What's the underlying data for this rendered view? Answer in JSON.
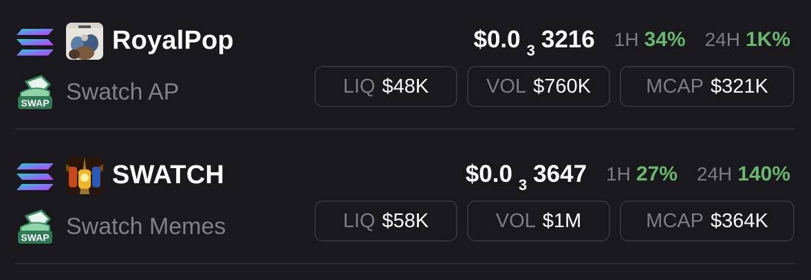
{
  "colors": {
    "background": "#19181d",
    "positive": "#67b86d",
    "muted": "#7d7c82",
    "border": "#333238"
  },
  "tokens": [
    {
      "chain_icon": "solana-icon",
      "name": "RoyalPop",
      "dex": "Swatch AP",
      "swap_badge": "SWAP",
      "price_prefix": "$0.0",
      "price_zeros": "3",
      "price_digits": "3216",
      "change_1h_label": "1H",
      "change_1h": "34%",
      "change_24h_label": "24H",
      "change_24h": "1K%",
      "liq_label": "LIQ",
      "liq": "$48K",
      "vol_label": "VOL",
      "vol": "$760K",
      "mcap_label": "MCAP",
      "mcap": "$321K"
    },
    {
      "chain_icon": "solana-icon",
      "name": "SWATCH",
      "dex": "Swatch Memes",
      "swap_badge": "SWAP",
      "price_prefix": "$0.0",
      "price_zeros": "3",
      "price_digits": "3647",
      "change_1h_label": "1H",
      "change_1h": "27%",
      "change_24h_label": "24H",
      "change_24h": "140%",
      "liq_label": "LIQ",
      "liq": "$58K",
      "vol_label": "VOL",
      "vol": "$1M",
      "mcap_label": "MCAP",
      "mcap": "$364K"
    }
  ]
}
